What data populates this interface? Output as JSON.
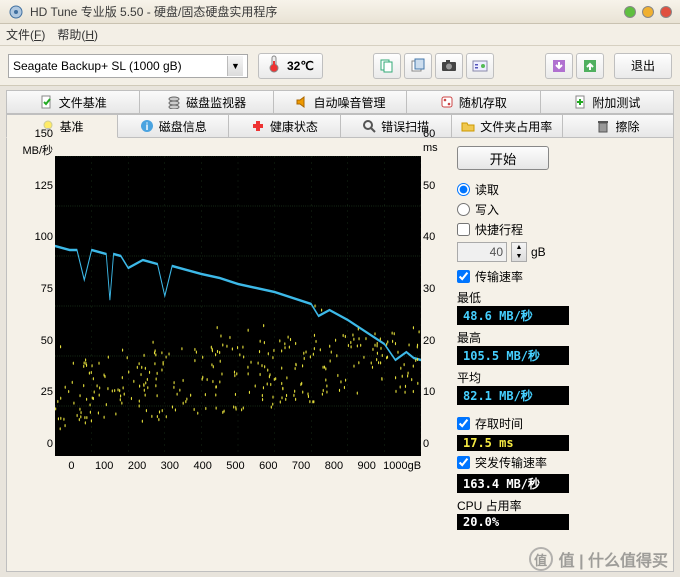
{
  "window": {
    "title": "HD Tune 专业版 5.50 - 硬盘/固态硬盘实用程序"
  },
  "menu": {
    "file": "文件",
    "file_mn": "F",
    "help": "帮助",
    "help_mn": "H"
  },
  "toolbar": {
    "drive": "Seagate Backup+ SL (1000 gB)",
    "temp": "32℃",
    "exit": "退出"
  },
  "tabs_row1": [
    {
      "icon": "doc-check",
      "label": "文件基准"
    },
    {
      "icon": "disks",
      "label": "磁盘监视器"
    },
    {
      "icon": "speaker",
      "label": "自动噪音管理"
    },
    {
      "icon": "dice",
      "label": "随机存取"
    },
    {
      "icon": "plus-doc",
      "label": "附加测试"
    }
  ],
  "tabs_row2": [
    {
      "icon": "bulb",
      "label": "基准",
      "active": true
    },
    {
      "icon": "info",
      "label": "磁盘信息"
    },
    {
      "icon": "cross",
      "label": "健康状态"
    },
    {
      "icon": "magnifier",
      "label": "错误扫描"
    },
    {
      "icon": "folder",
      "label": "文件夹占用率"
    },
    {
      "icon": "eraser",
      "label": "擦除"
    }
  ],
  "chart_data": {
    "type": "line+scatter",
    "title": "",
    "x_unit": "gB",
    "x_range": [
      0,
      1000
    ],
    "x_ticks": [
      0,
      100,
      200,
      300,
      400,
      500,
      600,
      700,
      800,
      900,
      1000
    ],
    "y_left": {
      "unit": "MB/秒",
      "range": [
        0,
        150
      ],
      "ticks": [
        0,
        25,
        50,
        75,
        100,
        125,
        150
      ]
    },
    "y_right": {
      "unit": "ms",
      "range": [
        0,
        60
      ],
      "ticks": [
        0,
        10,
        20,
        30,
        40,
        50,
        60
      ]
    },
    "series": [
      {
        "name": "transfer_rate",
        "axis": "left",
        "color": "#3db9e8",
        "style": "line",
        "x": [
          0,
          20,
          40,
          60,
          80,
          100,
          120,
          140,
          150,
          160,
          180,
          200,
          240,
          280,
          300,
          320,
          360,
          400,
          450,
          500,
          550,
          600,
          650,
          700,
          720,
          750,
          800,
          850,
          900,
          930,
          960,
          980,
          1000
        ],
        "y": [
          105,
          104,
          103,
          103,
          88,
          103,
          102,
          101,
          78,
          101,
          100,
          94,
          98,
          96,
          80,
          95,
          93,
          91,
          89,
          86,
          84,
          82,
          79,
          76,
          70,
          73,
          68,
          62,
          56,
          48,
          52,
          49,
          48
        ]
      },
      {
        "name": "access_time",
        "axis": "right",
        "color": "#e8e23c",
        "style": "scatter",
        "note": "cloud of ~300 points between y≈8 and y≈28 skewing upward with x, mean≈17.5"
      }
    ]
  },
  "side": {
    "start": "开始",
    "read": "读取",
    "write": "写入",
    "shortstroke": "快捷行程",
    "shortstroke_val": "40",
    "shortstroke_unit": "gB",
    "transfer_rate": "传输速率",
    "min_label": "最低",
    "min_val": "48.6 MB/秒",
    "max_label": "最高",
    "max_val": "105.5 MB/秒",
    "avg_label": "平均",
    "avg_val": "82.1 MB/秒",
    "access_label": "存取时间",
    "access_val": "17.5 ms",
    "burst_label": "突发传输速率",
    "burst_val": "163.4 MB/秒",
    "cpu_label": "CPU 占用率",
    "cpu_val": "20.0%"
  },
  "watermark": "值 | 什么值得买"
}
